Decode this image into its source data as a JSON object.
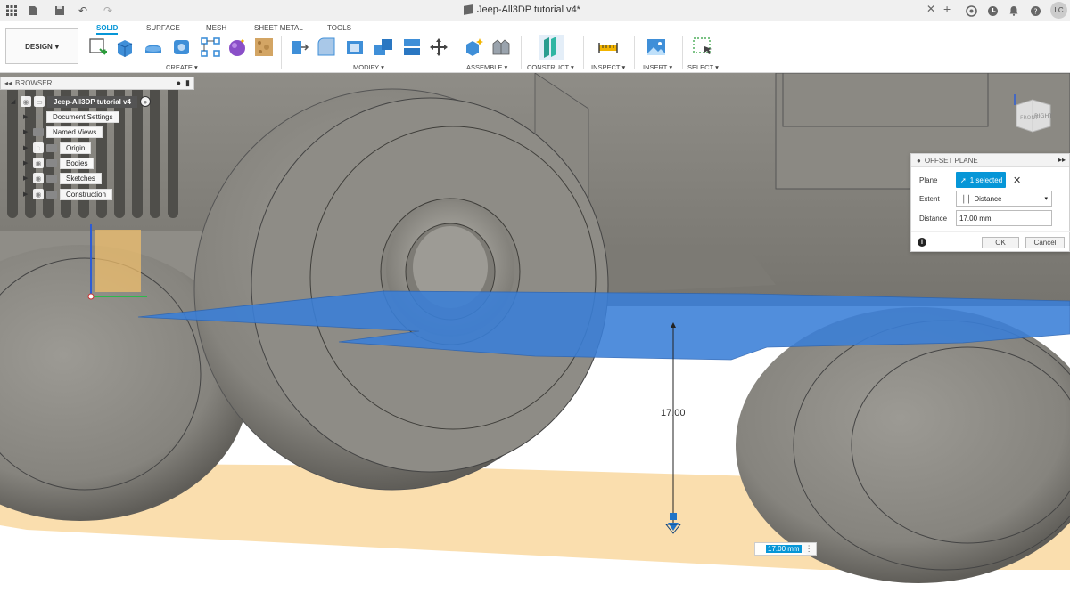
{
  "window": {
    "title": "Jeep-All3DP tutorial v4*",
    "user_initials": "LC"
  },
  "ribbon": {
    "workspace": "DESIGN",
    "tabs": [
      {
        "label": "SOLID",
        "active": true
      },
      {
        "label": "SURFACE",
        "active": false
      },
      {
        "label": "MESH",
        "active": false
      },
      {
        "label": "SHEET METAL",
        "active": false
      },
      {
        "label": "TOOLS",
        "active": false
      }
    ],
    "groups": {
      "create": "CREATE ▾",
      "modify": "MODIFY ▾",
      "assemble": "ASSEMBLE ▾",
      "construct": "CONSTRUCT ▾",
      "inspect": "INSPECT ▾",
      "insert": "INSERT ▾",
      "select": "SELECT ▾"
    }
  },
  "browser": {
    "title": "BROWSER",
    "root": "Jeep-All3DP tutorial v4",
    "items": [
      {
        "label": "Document Settings",
        "icon": "gear-icon"
      },
      {
        "label": "Named Views",
        "icon": "folder-icon"
      },
      {
        "label": "Origin",
        "icon": "folder-icon"
      },
      {
        "label": "Bodies",
        "icon": "folder-icon"
      },
      {
        "label": "Sketches",
        "icon": "folder-icon"
      },
      {
        "label": "Construction",
        "icon": "folder-icon"
      }
    ]
  },
  "viewcube": {
    "front_label": "FRONT",
    "right_label": "RIGHT"
  },
  "offset_plane_panel": {
    "title": "OFFSET PLANE",
    "plane_label": "Plane",
    "plane_value": "1 selected",
    "extent_label": "Extent",
    "extent_value": "Distance",
    "distance_label": "Distance",
    "distance_value": "17.00 mm",
    "ok_label": "OK",
    "cancel_label": "Cancel"
  },
  "viewport": {
    "dimension_label": "17.00",
    "dimension_input": "17.00 mm"
  },
  "colors": {
    "accent": "#0696d7",
    "offset_plane": "#3a7fd8",
    "origin_plane": "#f5c26b",
    "model_gray": "#8e8c86"
  }
}
